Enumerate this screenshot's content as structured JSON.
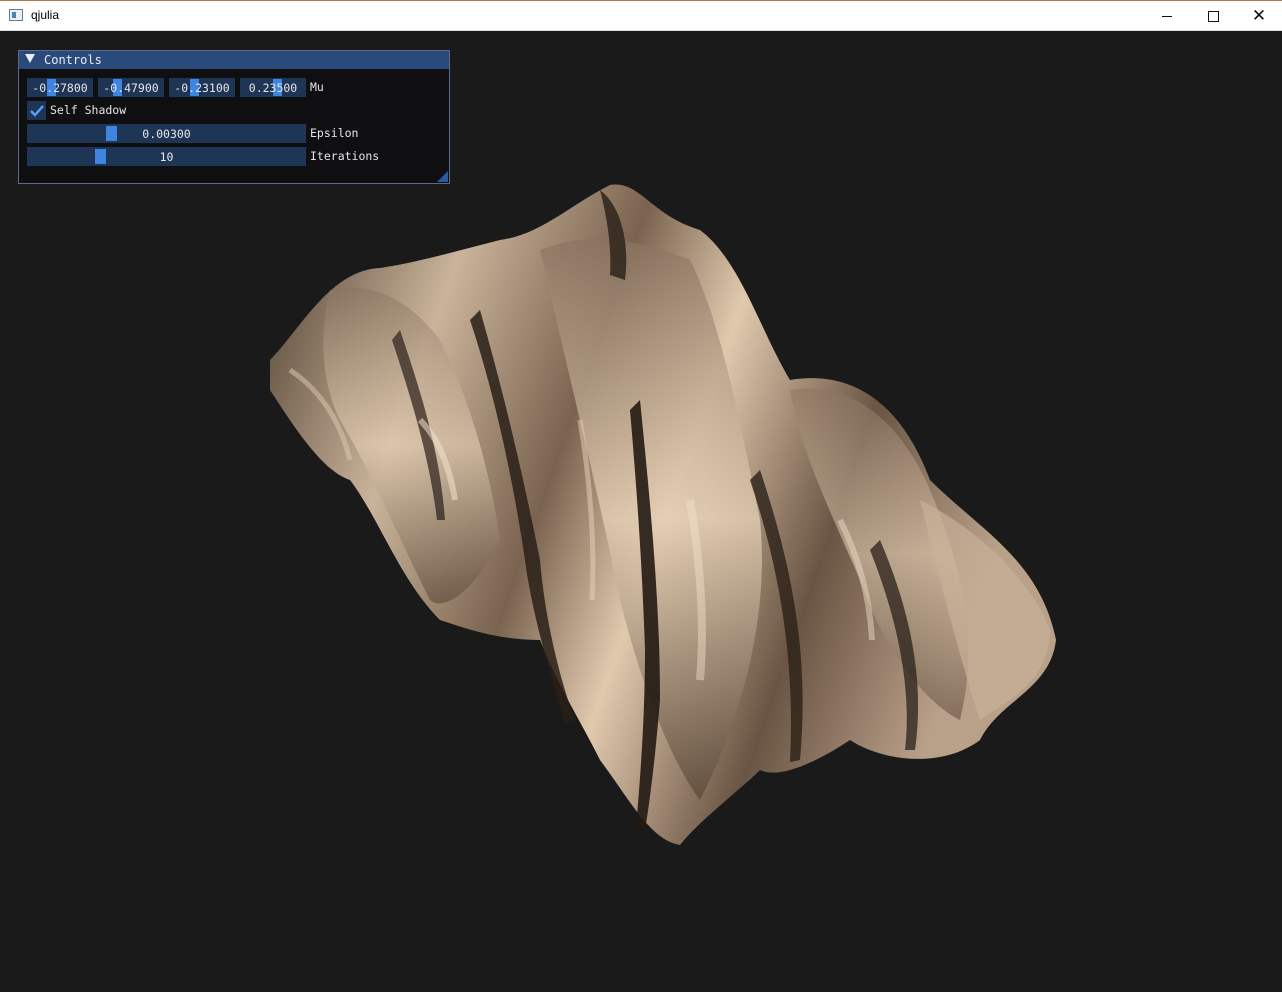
{
  "window": {
    "title": "qjulia",
    "minimize_icon": "minimize-icon",
    "maximize_icon": "maximize-icon",
    "close_icon": "close-icon"
  },
  "controls": {
    "title": "Controls",
    "mu": {
      "label": "Mu",
      "values": [
        "-0.27800",
        "-0.47900",
        "-0.23100",
        "0.23500"
      ]
    },
    "self_shadow": {
      "label": "Self Shadow",
      "checked": true
    },
    "epsilon": {
      "label": "Epsilon",
      "value": "0.00300"
    },
    "iterations": {
      "label": "Iterations",
      "value": "10"
    }
  },
  "scene": {
    "object": "quaternion-julia-fractal",
    "surface_color": "#b39c82",
    "background_color": "#1a1a1a"
  }
}
